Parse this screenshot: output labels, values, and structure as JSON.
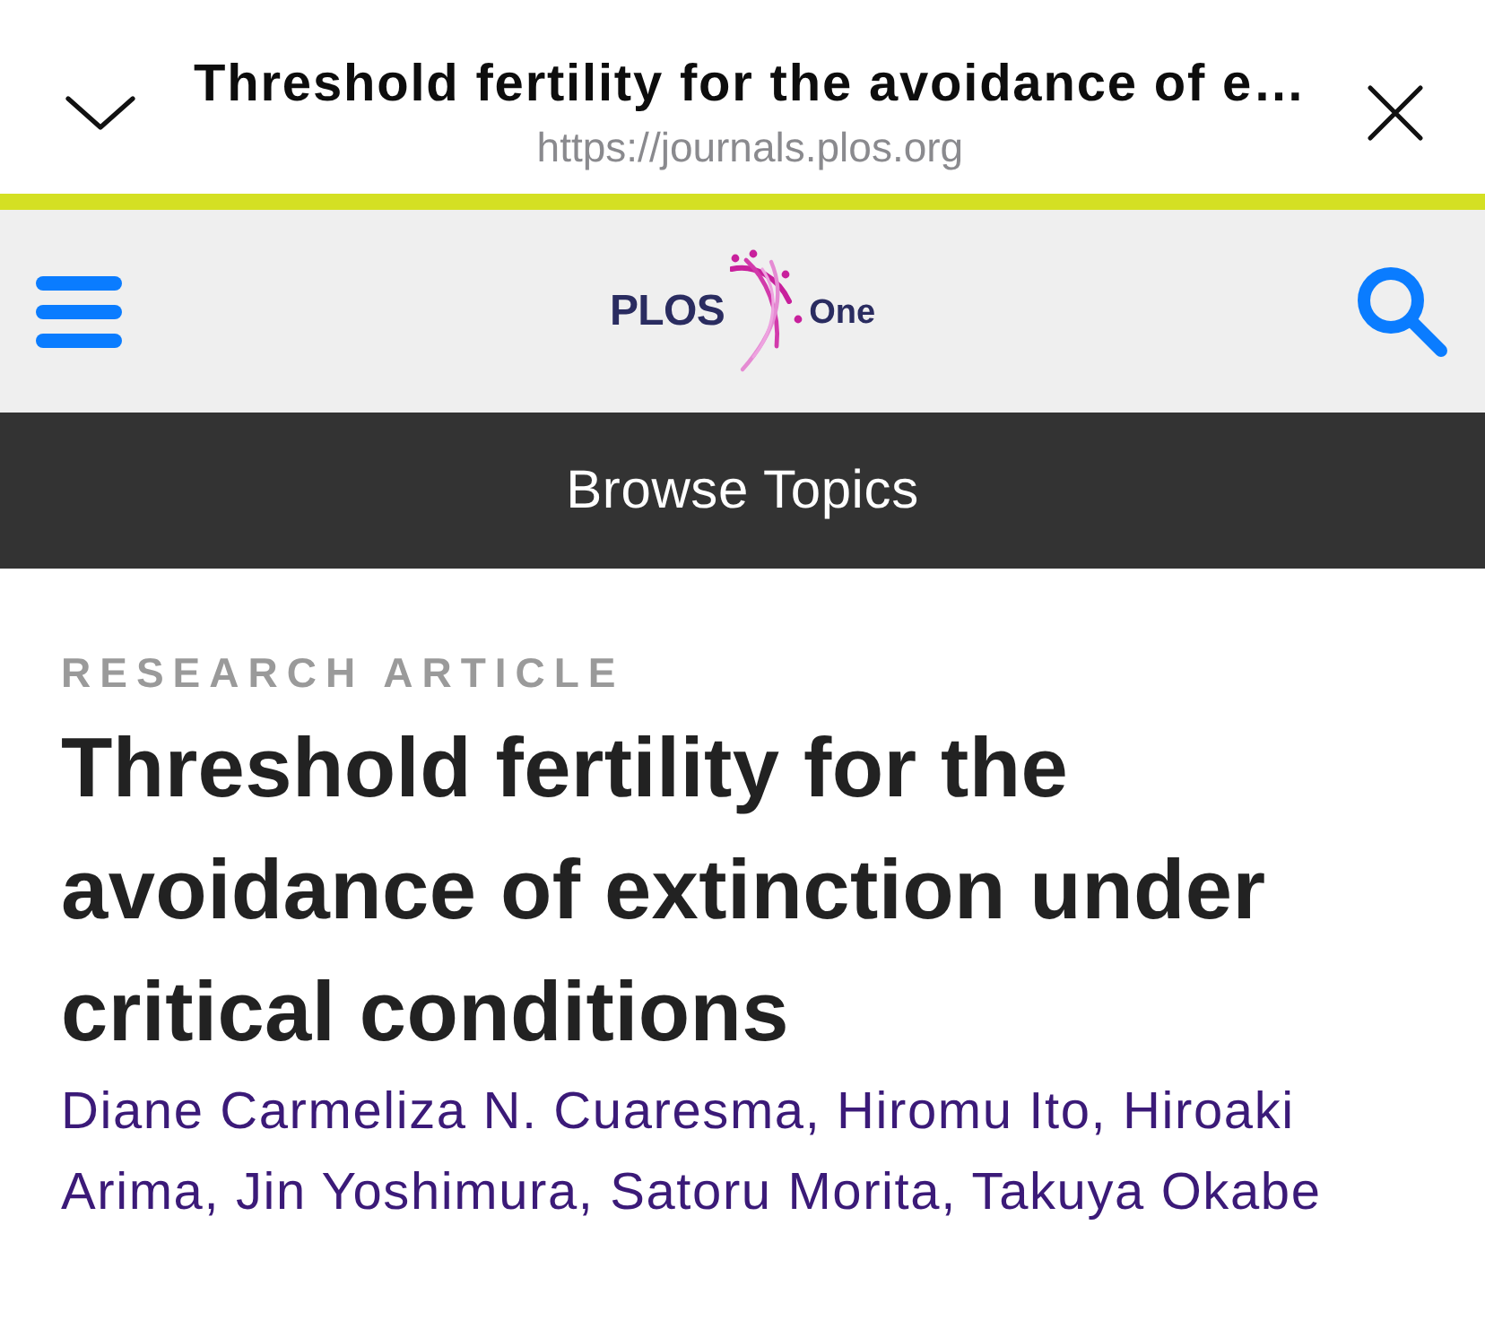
{
  "browser_bar": {
    "title": "Threshold fertility for the avoidance of e…",
    "url": "https://journals.plos.org"
  },
  "site_header": {
    "logo": {
      "wordmark": "PLOS",
      "product": "One"
    }
  },
  "nav_bar": {
    "label": "Browse Topics"
  },
  "article": {
    "type": "RESEARCH ARTICLE",
    "title": "Threshold fertility for the avoidance of extinction under critical conditions",
    "authors": "Diane Carmeliza N. Cuaresma, Hiromu Ito, Hiroaki Arima, Jin Yoshimura, Satoru Morita, Takuya Okabe"
  }
}
